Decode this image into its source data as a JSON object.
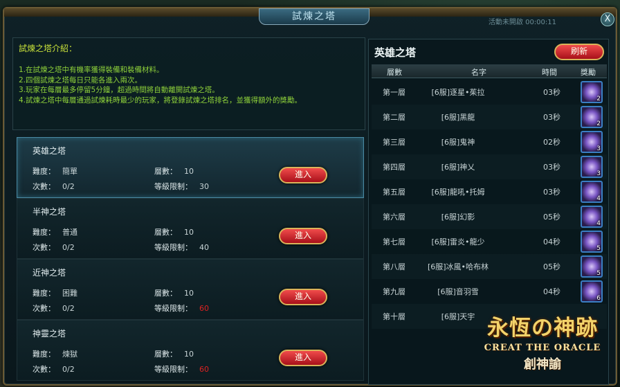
{
  "window": {
    "title": "試煉之塔",
    "top_status": "活動未開啟 00:00:11",
    "close_label": "X"
  },
  "intro": {
    "title": "試煉之塔介紹：",
    "lines": [
      "1.在試煉之塔中有機率獲得裝備和裝備材料。",
      "2.四個試煉之塔每日只能各進入兩次。",
      "3.玩家在每層最多停留5分鐘，超過時間將自動離開試煉之塔。",
      "4.試煉之塔中每層通過試煉耗時最少的玩家，將登錄試煉之塔排名，並獲得額外的獎勵。"
    ]
  },
  "labels": {
    "difficulty": "難度：",
    "count": "次數：",
    "floors": "層數：",
    "level_limit": "等級限制：",
    "enter": "進入"
  },
  "towers": [
    {
      "name": "英雄之塔",
      "difficulty": "簡單",
      "count": "0/2",
      "floors": "10",
      "level_limit": "30",
      "limit_red": false,
      "selected": true
    },
    {
      "name": "半神之塔",
      "difficulty": "普通",
      "count": "0/2",
      "floors": "10",
      "level_limit": "40",
      "limit_red": false,
      "selected": false
    },
    {
      "name": "近神之塔",
      "difficulty": "困難",
      "count": "0/2",
      "floors": "10",
      "level_limit": "60",
      "limit_red": true,
      "selected": false
    },
    {
      "name": "神靈之塔",
      "difficulty": "煉獄",
      "count": "0/2",
      "floors": "10",
      "level_limit": "60",
      "limit_red": true,
      "selected": false
    }
  ],
  "ranking": {
    "title": "英雄之塔",
    "refresh_label": "刷新",
    "headers": {
      "floor": "層數",
      "name": "名字",
      "time": "時間",
      "reward": "獎勵"
    },
    "rows": [
      {
        "floor": "第一層",
        "name": "[6服]逐星•茱拉",
        "time": "03秒",
        "reward_count": "2"
      },
      {
        "floor": "第二層",
        "name": "[6服]黑龍",
        "time": "03秒",
        "reward_count": "2"
      },
      {
        "floor": "第三層",
        "name": "[6服]鬼神",
        "time": "02秒",
        "reward_count": "3"
      },
      {
        "floor": "第四層",
        "name": "[6服]神乂",
        "time": "03秒",
        "reward_count": "3"
      },
      {
        "floor": "第五層",
        "name": "[6服]龍吼•托姆",
        "time": "03秒",
        "reward_count": "4"
      },
      {
        "floor": "第六層",
        "name": "[6服]幻影",
        "time": "05秒",
        "reward_count": "4"
      },
      {
        "floor": "第七層",
        "name": "[6服]雷炎•龍少",
        "time": "04秒",
        "reward_count": "5"
      },
      {
        "floor": "第八層",
        "name": "[6服]冰風•哈布林",
        "time": "05秒",
        "reward_count": "5"
      },
      {
        "floor": "第九層",
        "name": "[6服]音羽雪",
        "time": "04秒",
        "reward_count": "6"
      },
      {
        "floor": "第十層",
        "name": "[6服]天宇",
        "time": "",
        "reward_count": ""
      }
    ]
  },
  "logo": {
    "main": "永恆の神跡",
    "english": "CREAT THE ORACLE",
    "sub": "創神諭"
  },
  "colors": {
    "accent_gold": "#d9b45a",
    "intro_green": "#8fd23a",
    "button_red": "#c41e28",
    "limit_red": "#d22"
  }
}
